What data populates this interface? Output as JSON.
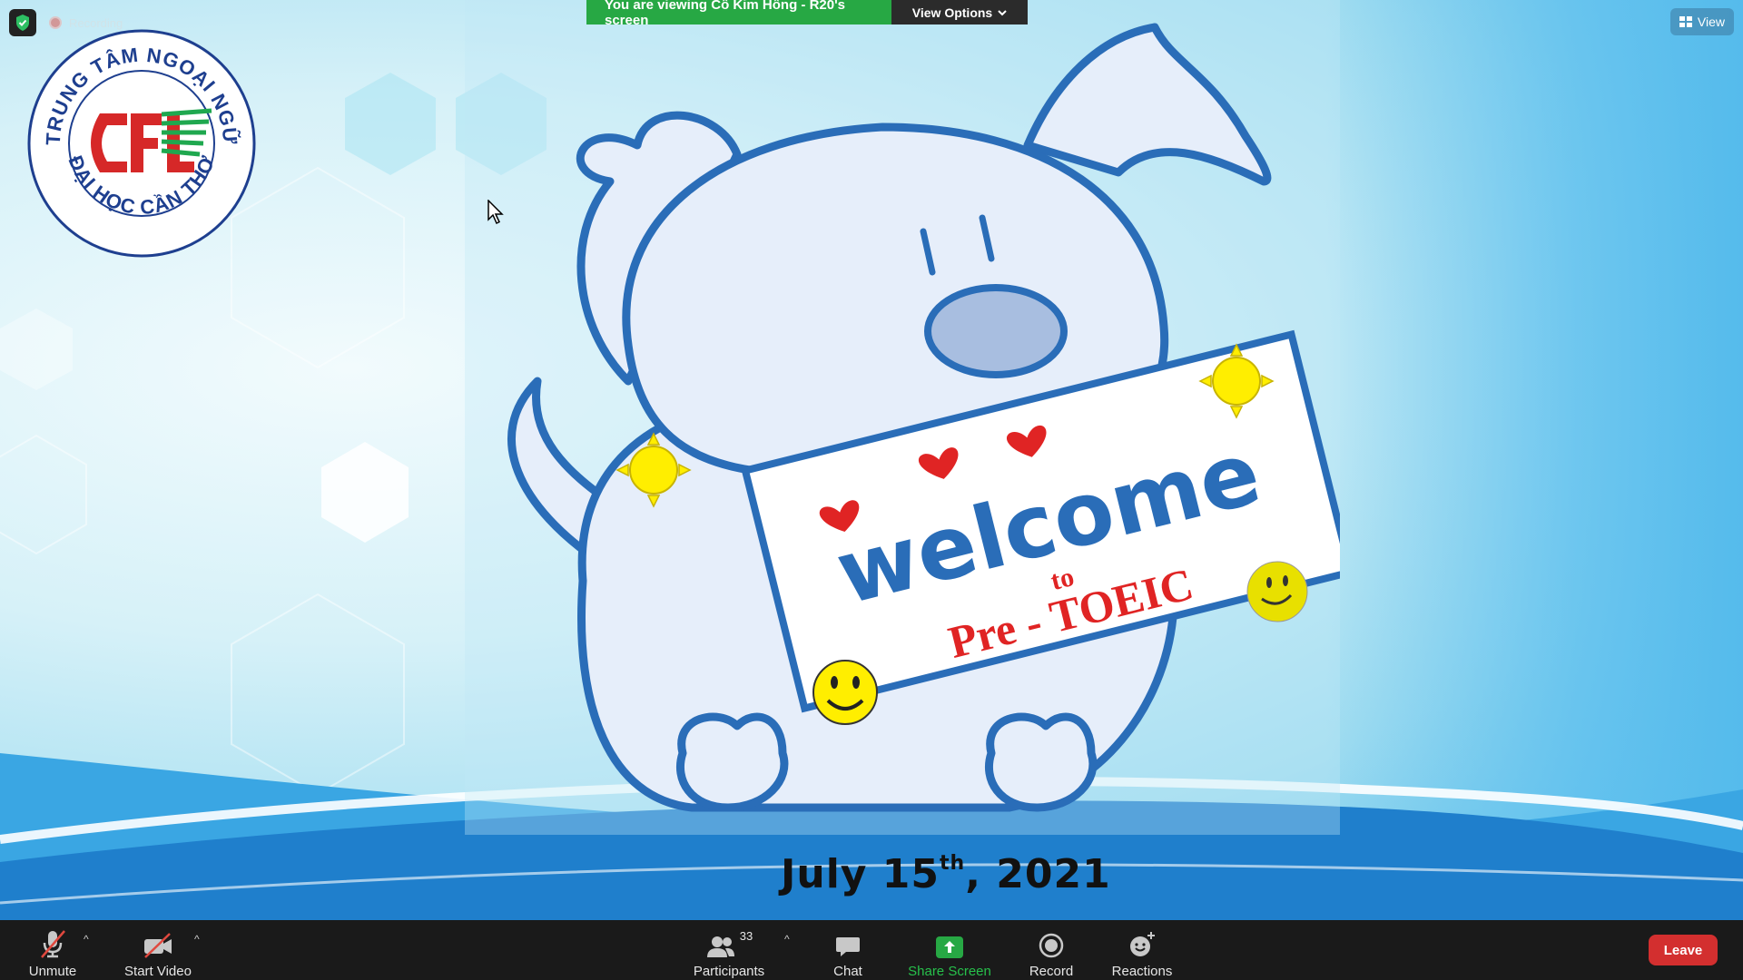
{
  "banner": {
    "viewing_text": "You are viewing Cô Kim Hồng - R20's screen",
    "view_options_label": "View Options"
  },
  "top_right": {
    "view_label": "View"
  },
  "top_left": {
    "recording_label": "Recording"
  },
  "logo": {
    "top_arc_text": "TRUNG TÂM NGOẠI NGỮ",
    "bottom_arc_text": "ĐẠI HỌC CẦN THƠ",
    "emblem_text": "CFL"
  },
  "slide": {
    "sign_word": "welcome",
    "sign_to": "to",
    "sign_course": "Pre - TOEIC",
    "date_main": "July 15",
    "date_sup": "th",
    "date_year": ", 2021"
  },
  "toolbar": {
    "unmute_label": "Unmute",
    "start_video_label": "Start Video",
    "participants_label": "Participants",
    "participants_count": "33",
    "chat_label": "Chat",
    "share_screen_label": "Share Screen",
    "record_label": "Record",
    "reactions_label": "Reactions",
    "leave_label": "Leave"
  },
  "colors": {
    "share_green": "#27a844",
    "leave_red": "#d32f2f",
    "toolbar_bg": "#1a1a1a"
  }
}
